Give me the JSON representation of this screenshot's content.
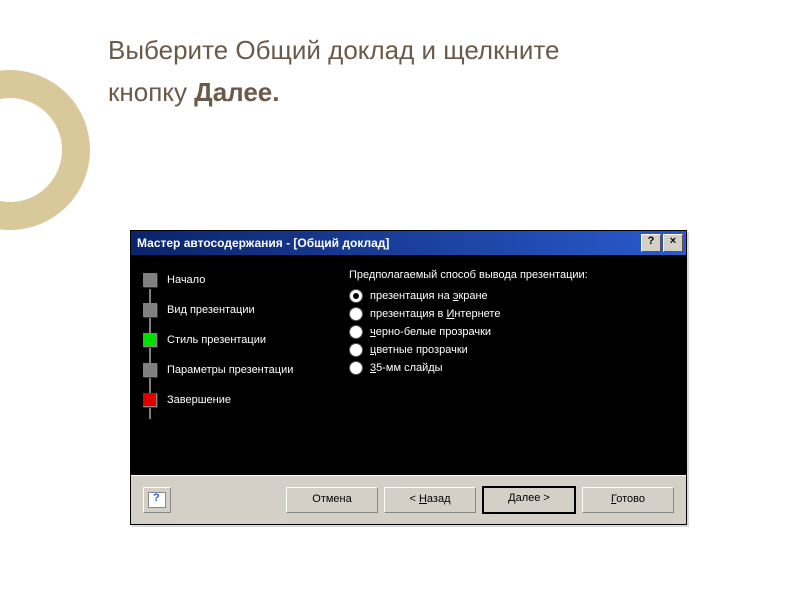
{
  "heading": {
    "line1": "Выберите Общий доклад и щелкните",
    "line2_prefix": "кнопку ",
    "line2_bold": "Далее."
  },
  "dialog": {
    "title": "Мастер автосодержания - [Общий доклад]",
    "steps": [
      {
        "label": "Начало",
        "color": "sb-grey"
      },
      {
        "label": "Вид презентации",
        "color": "sb-grey"
      },
      {
        "label": "Стиль презентации",
        "color": "sb-green"
      },
      {
        "label": "Параметры презентации",
        "color": "sb-grey"
      },
      {
        "label": "Завершение",
        "color": "sb-red"
      }
    ],
    "right_title": "Предполагаемый способ вывода презентации:",
    "options": [
      {
        "label_pre": "презентация на ",
        "u": "э",
        "label_post": "кране",
        "checked": true
      },
      {
        "label_pre": "презентация в ",
        "u": "И",
        "label_post": "нтернете",
        "checked": false
      },
      {
        "label_pre": "",
        "u": "ч",
        "label_post": "ерно-белые прозрачки",
        "checked": false
      },
      {
        "label_pre": "",
        "u": "ц",
        "label_post": "ветные прозрачки",
        "checked": false
      },
      {
        "label_pre": "",
        "u": "3",
        "label_post": "5-мм слайды",
        "checked": false
      }
    ],
    "buttons": {
      "cancel": "Отмена",
      "back_u": "Н",
      "back_rest": "азад",
      "back_prefix": "< ",
      "next_u": "Д",
      "next_rest": "алее >",
      "finish_u": "Г",
      "finish_rest": "отово"
    },
    "titlebar_help": "?",
    "titlebar_close": "×"
  }
}
